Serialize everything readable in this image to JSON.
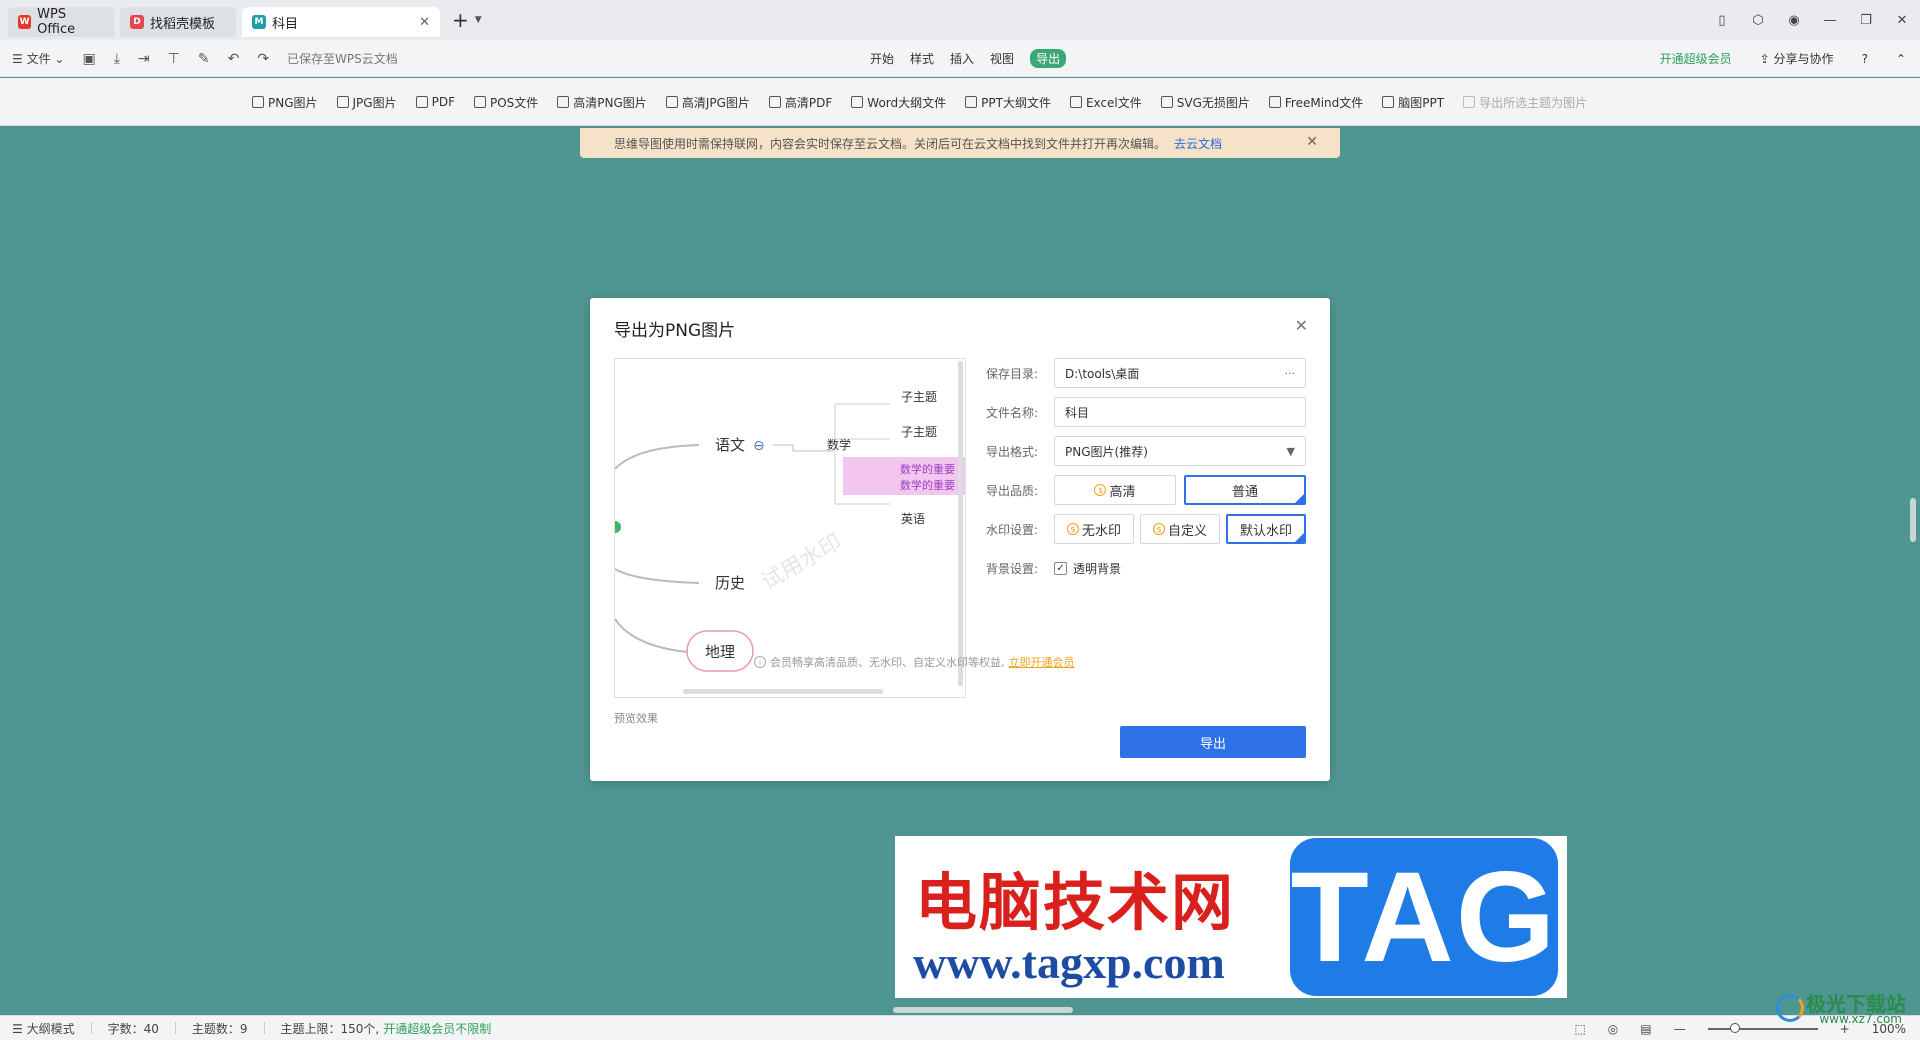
{
  "tabs": [
    {
      "label": "WPS Office",
      "icon": "wps-logo-icon"
    },
    {
      "label": "找稻壳模板",
      "icon": "docer-icon"
    },
    {
      "label": "科目",
      "icon": "mindmap-icon"
    }
  ],
  "menubar": {
    "file": "文件",
    "saved": "已保存至WPS云文档",
    "menus": [
      "开始",
      "样式",
      "插入",
      "视图",
      "导出"
    ],
    "vip": "开通超级会员",
    "share": "分享与协作",
    "help": "?"
  },
  "export_toolbar": [
    {
      "label": "PNG图片",
      "enabled": true
    },
    {
      "label": "JPG图片",
      "enabled": true
    },
    {
      "label": "PDF",
      "enabled": true
    },
    {
      "label": "POS文件",
      "enabled": true
    },
    {
      "label": "高清PNG图片",
      "enabled": true
    },
    {
      "label": "高清JPG图片",
      "enabled": true
    },
    {
      "label": "高清PDF",
      "enabled": true
    },
    {
      "label": "Word大纲文件",
      "enabled": true
    },
    {
      "label": "PPT大纲文件",
      "enabled": true
    },
    {
      "label": "Excel文件",
      "enabled": true
    },
    {
      "label": "SVG无损图片",
      "enabled": true
    },
    {
      "label": "FreeMind文件",
      "enabled": true
    },
    {
      "label": "脑图PPT",
      "enabled": true
    },
    {
      "label": "导出所选主题为图片",
      "enabled": false
    }
  ],
  "notice": {
    "text": "思维导图使用时需保持联网，内容会实时保存至云文档。关闭后可在云文档中找到文件并打开再次编辑。",
    "link": "去云文档"
  },
  "dialog": {
    "title": "导出为PNG图片",
    "preview_label": "预览效果",
    "preview": {
      "watermark": "试用水印",
      "nodes": {
        "chinese": "语文",
        "math": "数学",
        "sub1": "子主题",
        "sub2": "子主题",
        "hl1": "数学的重要",
        "hl2": "数学的重要",
        "english": "英语",
        "history": "历史",
        "geo": "地理"
      }
    },
    "fields": {
      "save_dir_label": "保存目录:",
      "save_dir": "D:\\tools\\桌面",
      "browse": "···",
      "filename_label": "文件名称:",
      "filename": "科目",
      "format_label": "导出格式:",
      "format": "PNG图片(推荐)",
      "quality_label": "导出品质:",
      "quality_options": [
        "高清",
        "普通"
      ],
      "quality_selected": "普通",
      "watermark_label": "水印设置:",
      "watermark_options": [
        "无水印",
        "自定义",
        "默认水印"
      ],
      "watermark_selected": "默认水印",
      "bg_label": "背景设置:",
      "bg_option": "透明背景",
      "bg_checked": true
    },
    "member_note": "会员畅享高清品质、无水印、自定义水印等权益,",
    "member_link": "立即开通会员",
    "export_button": "导出"
  },
  "banner": {
    "cn": "电脑技术网",
    "url": "www.tagxp.com",
    "tag": "TAG"
  },
  "statusbar": {
    "mode": "大纲模式",
    "words": "字数：40",
    "topics": "主题数：9",
    "limit": "主题上限：150个,",
    "vip": "开通超级会员不限制",
    "zoom": "100%"
  },
  "corner_logo": {
    "title": "极光下载站",
    "url": "www.xz7.com"
  },
  "colors": {
    "canvas": "#4f9693",
    "accent": "#2f72e8",
    "vip_green": "#2f9e5e",
    "member_orange": "#f0a21b"
  }
}
